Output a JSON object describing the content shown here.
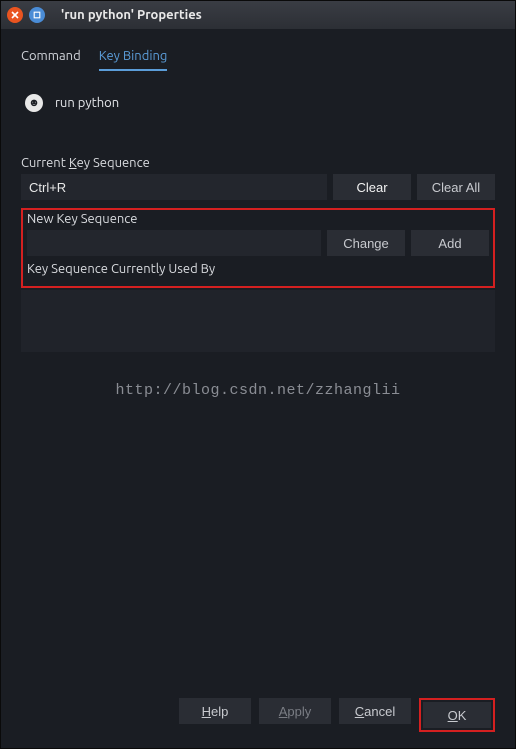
{
  "window": {
    "title": "'run python' Properties"
  },
  "tabs": {
    "command": "Command",
    "keybinding": "Key Binding"
  },
  "tool": {
    "name": "run python"
  },
  "labels": {
    "current_seq_pre": "Current ",
    "current_seq_key": "K",
    "current_seq_post": "ey Sequence",
    "new_seq": "New Key Sequence",
    "used_by": "Key Sequence Currently Used By"
  },
  "fields": {
    "current_value": "Ctrl+R",
    "new_value": ""
  },
  "buttons": {
    "clear": "Clear",
    "clear_all": "Clear All",
    "change": "Change",
    "add": "Add",
    "help_u": "H",
    "help_r": "elp",
    "apply_u": "A",
    "apply_r": "pply",
    "cancel_u": "C",
    "cancel_r": "ancel",
    "ok_u": "O",
    "ok_r": "K"
  },
  "watermark": "http://blog.csdn.net/zzhanglii"
}
